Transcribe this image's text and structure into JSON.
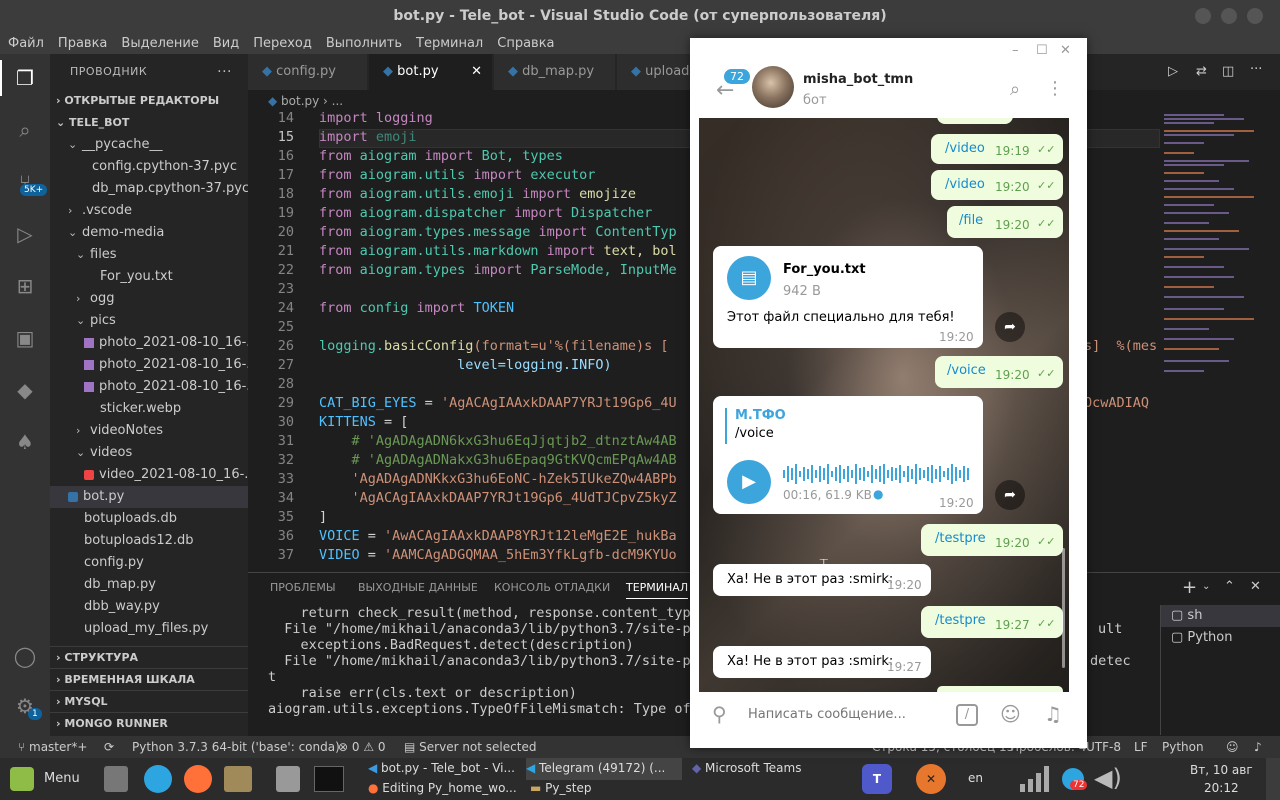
{
  "window": {
    "title": "bot.py - Tele_bot - Visual Studio Code (от суперпользователя)"
  },
  "menu": [
    "Файл",
    "Правка",
    "Выделение",
    "Вид",
    "Переход",
    "Выполнить",
    "Терминал",
    "Справка"
  ],
  "activity": {
    "source_control_badge": "5K+",
    "settings_badge": "1"
  },
  "sidebar": {
    "title": "ПРОВОДНИК",
    "open_editors": "ОТКРЫТЫЕ РЕДАКТОРЫ",
    "project": "TELE_BOT",
    "items": [
      "__pycache__",
      "config.cpython-37.pyc",
      "db_map.cpython-37.pyc",
      ".vscode",
      "demo-media",
      "files",
      "For_you.txt",
      "ogg",
      "pics",
      "photo_2021-08-10_16-...",
      "photo_2021-08-10_16-...",
      "photo_2021-08-10_16-...",
      "sticker.webp",
      "videoNotes",
      "videos",
      "video_2021-08-10_16-...",
      "bot.py",
      "botuploads.db",
      "botuploads12.db",
      "config.py",
      "db_map.py",
      "dbb_way.py",
      "upload_my_files.py"
    ],
    "sections": [
      "СТРУКТУРА",
      "ВРЕМЕННАЯ ШКАЛА",
      "MYSQL",
      "MONGO RUNNER"
    ]
  },
  "tabs": [
    "config.py",
    "bot.py",
    "db_map.py",
    "upload"
  ],
  "breadcrumb": "bot.py › ...",
  "code": {
    "line_numbers": [
      "14",
      "15",
      "16",
      "17",
      "18",
      "19",
      "20",
      "21",
      "22",
      "23",
      "24",
      "25",
      "26",
      "27",
      "28",
      "29",
      "30",
      "31",
      "32",
      "33",
      "34",
      "35",
      "36",
      "37"
    ],
    "l14": "import logging",
    "l15a": "import",
    "l15b": " emoji",
    "l16a": "from",
    "l16b": " aiogram ",
    "l16c": "import",
    "l16d": " Bot, types",
    "l17a": "from",
    "l17b": " aiogram.utils ",
    "l17c": "import",
    "l17d": " executor",
    "l18a": "from",
    "l18b": " aiogram.utils.emoji ",
    "l18c": "import",
    "l18d": " emojize",
    "l19a": "from",
    "l19b": " aiogram.dispatcher ",
    "l19c": "import",
    "l19d": " Dispatcher",
    "l20a": "from",
    "l20b": " aiogram.types.message ",
    "l20c": "import",
    "l20d": " ContentTyp",
    "l21a": "from",
    "l21b": " aiogram.utils.markdown ",
    "l21c": "import",
    "l21d": " text, bol",
    "l22a": "from",
    "l22b": " aiogram.types ",
    "l22c": "import",
    "l22d": " ParseMode, InputMe",
    "l24a": "from",
    "l24b": " config ",
    "l24c": "import",
    "l24d": " TOKEN",
    "l26a": "logging.",
    "l26b": "basicConfig",
    "l26c": "(format=u'%(filename)s [",
    "l26r": "s]  %(mes",
    "l27": "                 level=logging.INFO)",
    "l29a": "CAT_BIG_EYES",
    "l29b": " = ",
    "l29c": "'AgACAgIAAxkDAAP7YRJt19Gp6_4U",
    "l29r": "OcwADIAQ",
    "l30a": "KITTENS",
    "l30b": " = [",
    "l31": "    # 'AgADAgADN6kxG3hu6EqJjqtjb2_dtnztAw4AB",
    "l32": "    # 'AgADAgADNakxG3hu6Epaq9GtKVQcmEPqAw4AB",
    "l33": "    'AgADAgADNKkxG3hu6EoNC-hZek5IUkeZQw4ABPb",
    "l34": "    'AgACAgIAAxkDAAP7YRJt19Gp6_4UdTJCpvZ5kyZ",
    "l35": "]",
    "l36a": "VOICE",
    "l36b": " = ",
    "l36c": "'AwACAgIAAxkDAAP8YRJt12leMgE2E_hukBa",
    "l37a": "VIDEO",
    "l37b": " = ",
    "l37c": "'AAMCAgADGQMAA_5hEm3YfkLgfb-dcM9KYUo"
  },
  "panel": {
    "tabs": [
      "ПРОБЛЕМЫ",
      "ВЫХОДНЫЕ ДАННЫЕ",
      "КОНСОЛЬ ОТЛАДКИ",
      "ТЕРМИНАЛ"
    ],
    "terminal_lines": [
      "    return check_result(method, response.content_type",
      "  File \"/home/mikhail/anaconda3/lib/python3.7/site-pa",
      "    exceptions.BadRequest.detect(description)",
      "  File \"/home/mikhail/anaconda3/lib/python3.7/site-pa",
      "t",
      "    raise err(cls.text or description)",
      "aiogram.utils.exceptions.TypeOfFileMismatch: Type of"
    ],
    "terminal_right": [
      "ult",
      "detec"
    ],
    "shells": [
      "sh",
      "Python"
    ]
  },
  "statusbar": {
    "branch": "master*+",
    "python": "Python 3.7.3 64-bit ('base': conda)",
    "problems": "⊗ 0 ⚠ 0",
    "server": "Server not selected",
    "position": "Строка 15, столбец 13",
    "spaces": "Пробелов: 4",
    "encoding": "UTF-8",
    "eol": "LF",
    "lang": "Python"
  },
  "taskbar": {
    "menu": "Menu",
    "tasks": [
      "bot.py - Tele_bot - Vi...",
      "Telegram (49172) (...",
      "Microsoft Teams",
      "Editing Py_home_wo...",
      "Py_step"
    ],
    "lang": "en",
    "date": "Вт, 10 авг",
    "time": "20:12",
    "tray_badge": "72"
  },
  "telegram": {
    "unread": "72",
    "contact": "misha_bot_tmn",
    "status": "бот",
    "messages": [
      {
        "text": "/video",
        "time": "19:19"
      },
      {
        "text": "/video",
        "time": "19:20"
      },
      {
        "text": "/file",
        "time": "19:20"
      },
      {
        "file_name": "For_you.txt",
        "file_size": "942 B",
        "caption": "Этот файл специально для тебя!",
        "time": "19:20"
      },
      {
        "text": "/voice",
        "time": "19:20"
      },
      {
        "reply_author": "М.ТФО",
        "reply_text": "/voice",
        "duration": "00:16, 61.9 KB",
        "time": "19:20"
      },
      {
        "text": "/testpre",
        "time": "19:20"
      },
      {
        "text": "Ха! Не в этот раз :smirk:",
        "time": "19:20"
      },
      {
        "text": "/testpre",
        "time": "19:27"
      },
      {
        "text": "Ха! Не в этот раз :smirk:",
        "time": "19:27"
      }
    ],
    "input_placeholder": "Написать сообщение..."
  },
  "colors": {
    "vscode_bg": "#1e1e1e",
    "telegram_accent": "#3ca5dc",
    "outgoing_bubble": "#effdde"
  }
}
